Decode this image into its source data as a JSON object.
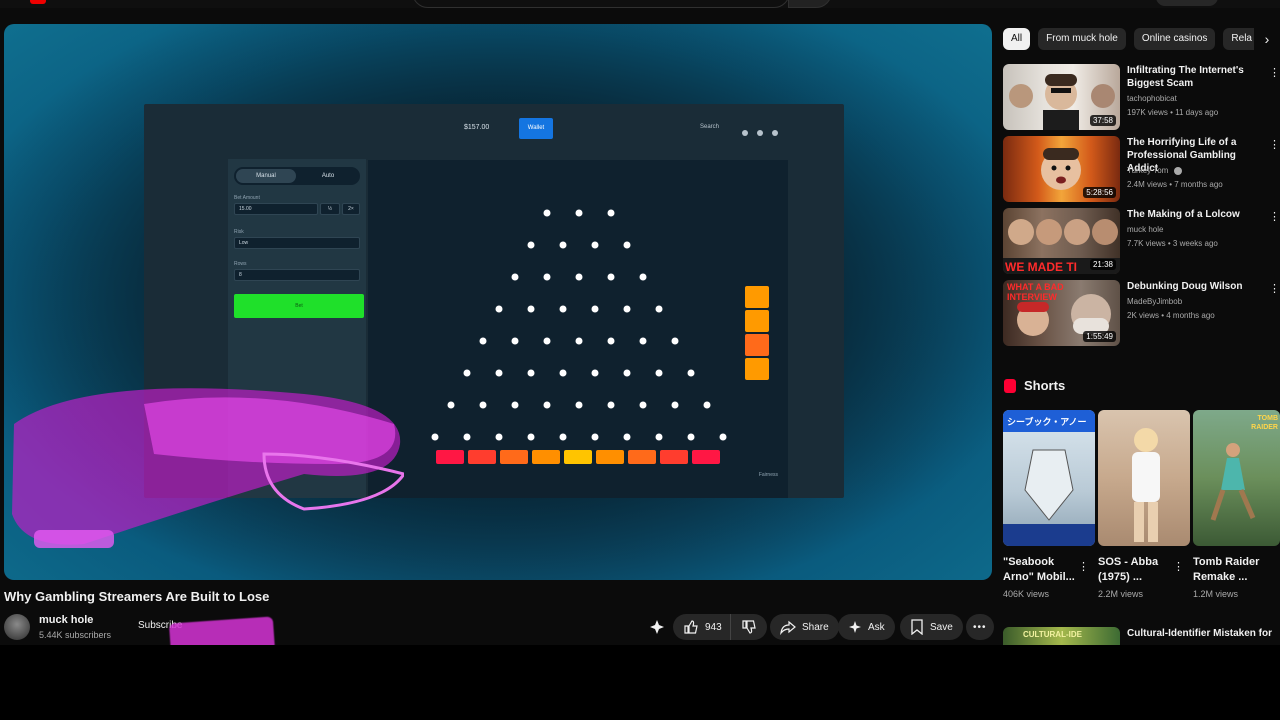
{
  "video": {
    "title": "Why Gambling Streamers Are Built to Lose",
    "game": {
      "balance": "$157.00",
      "wallet_label": "Wallet",
      "search_label": "Search",
      "tab_manual": "Manual",
      "tab_auto": "Auto",
      "bet_amount_label": "Bet Amount",
      "bet_amount_value": "15.00",
      "risk_label": "Risk",
      "risk_value": "Low",
      "rows_label": "Rows",
      "rows_value": "8",
      "bet_button": "Bet",
      "fairness": "Fairness",
      "half_label": "½",
      "double_label": "2×"
    }
  },
  "channel": {
    "name": "muck hole",
    "subscribers": "5.44K subscribers",
    "subscribe_label": "Subscribe"
  },
  "actions": {
    "likes": "943",
    "share": "Share",
    "ask": "Ask",
    "save": "Save"
  },
  "chips": [
    "All",
    "From muck hole",
    "Online casinos",
    "Rela"
  ],
  "recommendations": [
    {
      "title": "Infiltrating The Internet's Biggest Scam",
      "channel": "tachophobicat",
      "meta": "197K views • 11 days ago",
      "duration": "37:58",
      "verified": false
    },
    {
      "title": "The Horrifying Life of a Professional Gambling Addict",
      "channel": "Turkey Tom",
      "meta": "2.4M views • 7 months ago",
      "duration": "5:28:56",
      "verified": true
    },
    {
      "title": "The Making of a Lolcow",
      "channel": "muck hole",
      "meta": "7.7K views • 3 weeks ago",
      "duration": "21:38",
      "verified": false,
      "thumb_text": "WE MADE TI"
    },
    {
      "title": "Debunking Doug Wilson",
      "channel": "MadeByJimbob",
      "meta": "2K views • 4 months ago",
      "duration": "1:55:49",
      "verified": false,
      "thumb_text": "WHAT A BAD INTERVIEW"
    }
  ],
  "shorts": {
    "heading": "Shorts",
    "items": [
      {
        "title": "\"Seabook Arno\" Mobil...",
        "views": "406K views",
        "thumb_text": "シーブック・アノー"
      },
      {
        "title": "SOS - Abba (1975) ...",
        "views": "2.2M views"
      },
      {
        "title": "Tomb Raider Remake ...",
        "views": "1.2M views",
        "thumb_text": "TOMB RAIDER"
      }
    ]
  },
  "next_rec": {
    "title": "Cultural-Identifier Mistaken for",
    "thumb_text": "CULTURAL-IDE"
  }
}
